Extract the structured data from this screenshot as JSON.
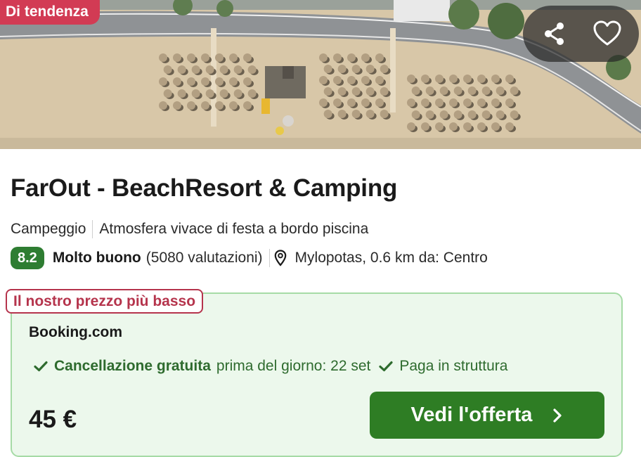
{
  "badge": {
    "trending": "Di tendenza"
  },
  "actions": {
    "share_icon": "share-icon",
    "favorite_icon": "heart-icon"
  },
  "listing": {
    "title": "FarOut - BeachResort & Camping",
    "type": "Campeggio",
    "tagline": "Atmosfera vivace di festa a bordo piscina",
    "rating": {
      "score": "8.2",
      "label": "Molto buono",
      "count": "(5080 valutazioni)"
    },
    "location": "Mylopotas, 0.6 km da: Centro"
  },
  "offer": {
    "badge": "Il nostro prezzo più basso",
    "provider": "Booking.com",
    "perk_free_cancel": "Cancellazione gratuita",
    "perk_free_cancel_detail": "prima del giorno: 22 set",
    "perk_pay_at_property": "Paga in struttura",
    "price": "45 €",
    "cta_label": "Vedi l'offerta"
  },
  "colors": {
    "trend_badge": "#d23b54",
    "rating_badge": "#2e7d32",
    "offer_bg": "#ecf8ec",
    "cta": "#2e7d24",
    "lowest_badge_border": "#b5344c"
  }
}
